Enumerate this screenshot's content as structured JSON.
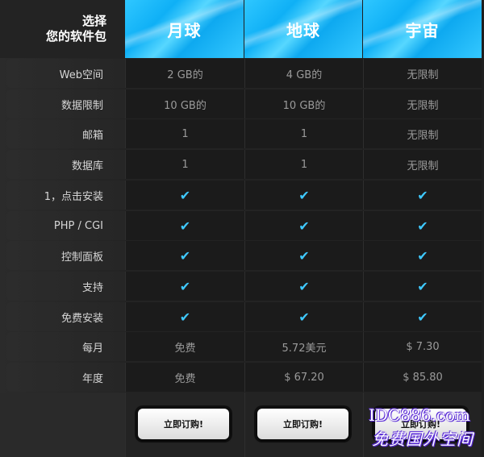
{
  "header": {
    "title_line1": "选择",
    "title_line2": "您的软件包"
  },
  "plans": [
    {
      "name": "月球",
      "button": "立即订购!"
    },
    {
      "name": "地球",
      "button": "立即订购!"
    },
    {
      "name": "宇宙",
      "button": "立即订购!"
    }
  ],
  "rows": [
    {
      "label": "Web空间",
      "values": [
        "2 GB的",
        "4 GB的",
        "无限制"
      ]
    },
    {
      "label": "数据限制",
      "values": [
        "10 GB的",
        "10 GB的",
        "无限制"
      ]
    },
    {
      "label": "邮箱",
      "values": [
        "1",
        "1",
        "无限制"
      ]
    },
    {
      "label": "数据库",
      "values": [
        "1",
        "1",
        "无限制"
      ]
    },
    {
      "label": "1，点击安装",
      "values": [
        "✔",
        "✔",
        "✔"
      ]
    },
    {
      "label": "PHP / CGI",
      "values": [
        "✔",
        "✔",
        "✔"
      ]
    },
    {
      "label": "控制面板",
      "values": [
        "✔",
        "✔",
        "✔"
      ]
    },
    {
      "label": "支持",
      "values": [
        "✔",
        "✔",
        "✔"
      ]
    },
    {
      "label": "免费安装",
      "values": [
        "✔",
        "✔",
        "✔"
      ]
    },
    {
      "label": "每月",
      "values": [
        "免费",
        "5.72美元",
        "$ 7.30"
      ]
    },
    {
      "label": "年度",
      "values": [
        "免费",
        "$ 67.20",
        "$ 85.80"
      ]
    }
  ],
  "watermark": {
    "line1": "IDC886.com",
    "line2": "免费国外空间"
  },
  "colors": {
    "accent": "#0fb0f6",
    "check": "#3fc9ff"
  }
}
